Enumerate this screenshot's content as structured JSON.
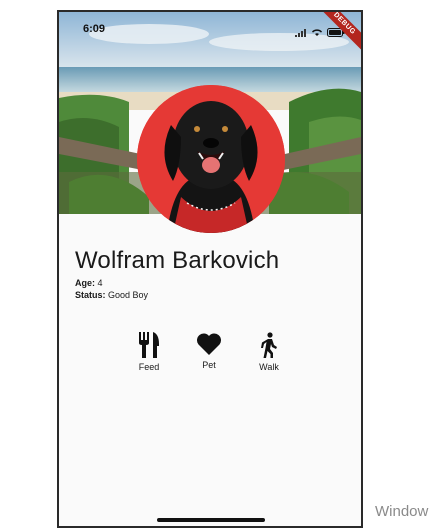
{
  "app": {
    "debug_banner": "DEBUG"
  },
  "status_bar": {
    "time": "6:09",
    "icons": [
      "signal-icon",
      "wifi-icon",
      "battery-icon"
    ]
  },
  "profile": {
    "name": "Wolfram Barkovich",
    "age_label": "Age:",
    "age_value": "4",
    "status_label": "Status:",
    "status_value": "Good Boy"
  },
  "actions": [
    {
      "label": "Feed",
      "icon": "fork-knife-icon"
    },
    {
      "label": "Pet",
      "icon": "heart-icon"
    },
    {
      "label": "Walk",
      "icon": "walking-person-icon"
    }
  ],
  "overlay": {
    "windows_watermark": "Window"
  },
  "colors": {
    "avatar_background": "#e53935",
    "debug_banner": "#b3261e",
    "text": "#1a1a1a"
  }
}
